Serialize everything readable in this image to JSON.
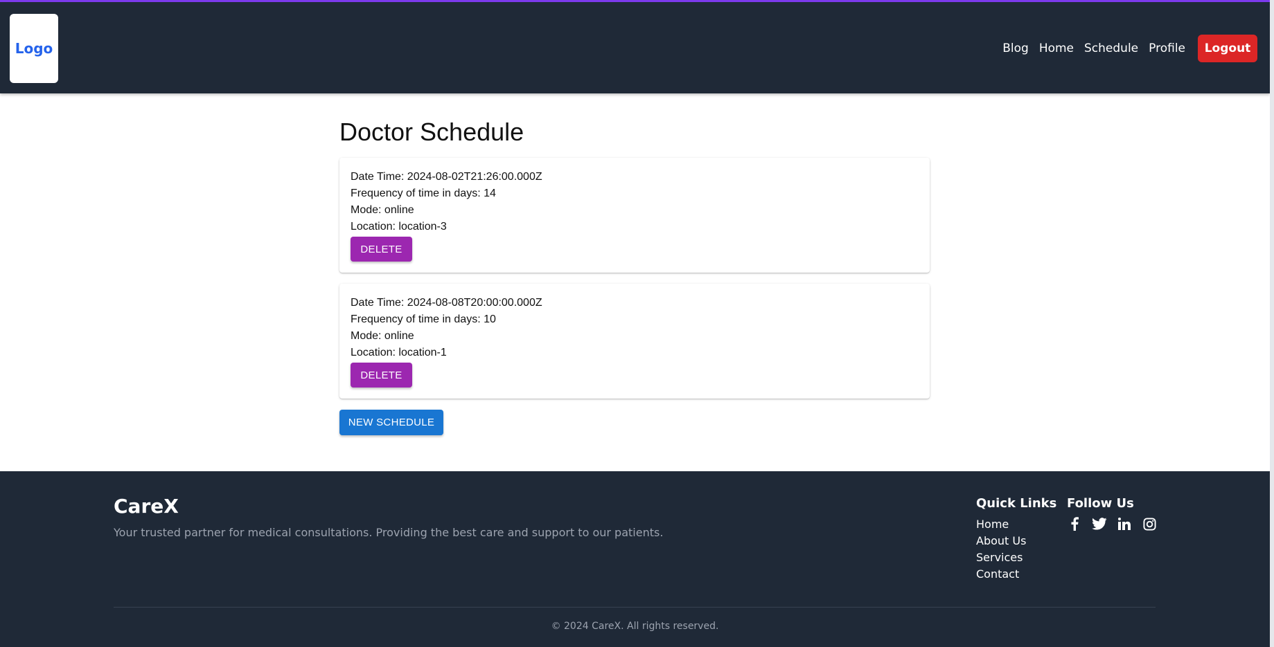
{
  "header": {
    "logo_text": "Logo",
    "nav": [
      "Blog",
      "Home",
      "Schedule",
      "Profile"
    ],
    "logout_label": "Logout",
    "accent_color": "#7c3aed"
  },
  "main": {
    "title": "Doctor Schedule",
    "schedules": [
      {
        "datetime": "Date Time: 2024-08-02T21:26:00.000Z",
        "frequency": "Frequency of time in days: 14",
        "mode": "Mode: online",
        "location": "Location: location-3",
        "delete_label": "DELETE"
      },
      {
        "datetime": "Date Time: 2024-08-08T20:00:00.000Z",
        "frequency": "Frequency of time in days: 10",
        "mode": "Mode: online",
        "location": "Location: location-1",
        "delete_label": "DELETE"
      }
    ],
    "new_schedule_label": "NEW SCHEDULE"
  },
  "footer": {
    "brand": "CareX",
    "tagline": "Your trusted partner for medical consultations. Providing the best care and support to our patients.",
    "quick_links_title": "Quick Links",
    "quick_links": [
      "Home",
      "About Us",
      "Services",
      "Contact"
    ],
    "follow_title": "Follow Us",
    "social_icons": [
      "facebook-icon",
      "twitter-icon",
      "linkedin-icon",
      "instagram-icon"
    ],
    "copyright": "© 2024 CareX. All rights reserved."
  }
}
